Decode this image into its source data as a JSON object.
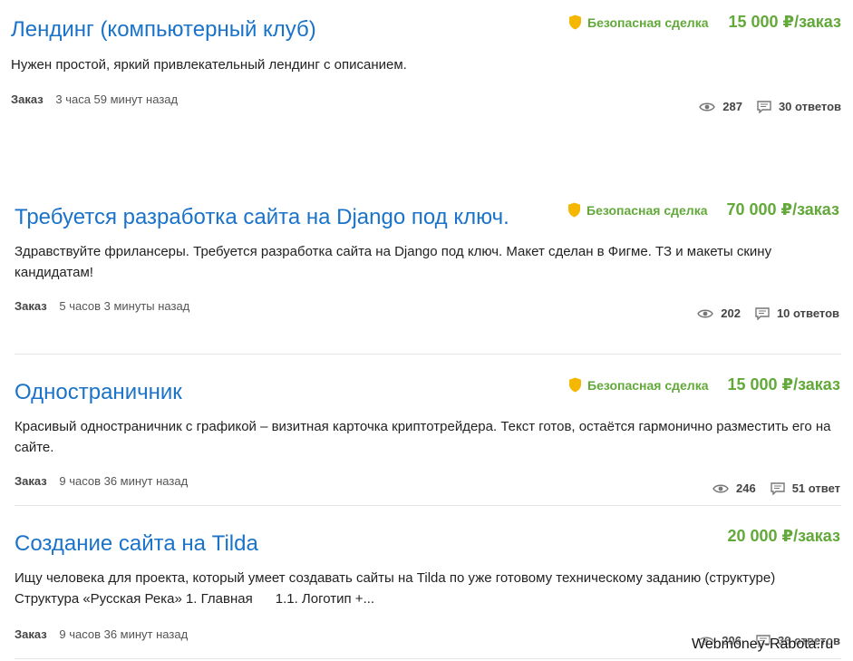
{
  "safe_deal_label": "Безопасная сделка",
  "orders": [
    {
      "title": "Лендинг (компьютерный клуб)",
      "safe_deal": true,
      "price": "15 000 ₽/заказ",
      "description": "Нужен простой, яркий привлекательный лендинг с описанием.",
      "kind": "Заказ",
      "time": "3 часа 59 минут назад",
      "views": "287",
      "responses": "30 ответов"
    },
    {
      "title": "Требуется разработка сайта на Django под ключ.",
      "safe_deal": true,
      "price": "70 000 ₽/заказ",
      "description": "Здравствуйте фрилансеры. Требуется разработка сайта на Django под ключ. Макет сделан в Фигме. ТЗ и макеты скину кандидатам!",
      "kind": "Заказ",
      "time": "5 часов 3 минуты назад",
      "views": "202",
      "responses": "10 ответов"
    },
    {
      "title": "Одностраничник",
      "safe_deal": true,
      "price": "15 000 ₽/заказ",
      "description": "Красивый одностраничник с графикой – визитная карточка криптотрейдера. Текст готов, остаётся гармонично разместить его на сайте.",
      "kind": "Заказ",
      "time": "9 часов 36 минут назад",
      "views": "246",
      "responses": "51 ответ"
    },
    {
      "title": "Создание сайта на Tilda",
      "safe_deal": false,
      "price": "20 000 ₽/заказ",
      "description": "Ищу человека для проекта, который умеет создавать сайты на Tilda по уже готовому техническому заданию (структуре) Структура «Русская Река» 1. Главная      1.1. Логотип +...",
      "kind": "Заказ",
      "time": "9 часов 36 минут назад",
      "views": "206",
      "responses": "36 ответов"
    }
  ],
  "watermark": "Webmoney-Rabota.ru",
  "colors": {
    "link": "#1a73c8",
    "price": "#62a93a",
    "shield": "#f5b700"
  }
}
